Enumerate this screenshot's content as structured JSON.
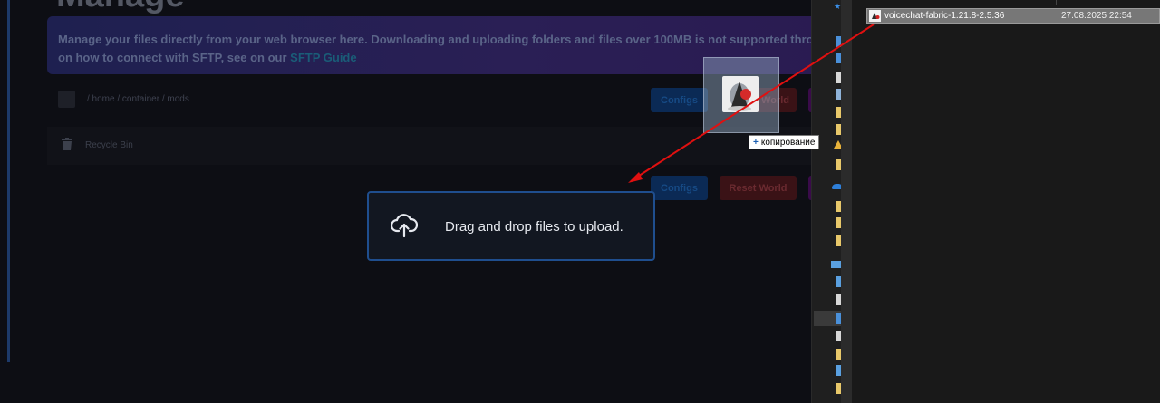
{
  "web": {
    "page_title": "Manage",
    "banner": {
      "line1": "Manage your files directly from your web browser here. Downloading and uploading folders and files over 100MB is not supported through",
      "line2_prefix": "on how to connect with SFTP, see on our ",
      "link": "SFTP Guide"
    },
    "breadcrumb": "/ home / container / mods",
    "toolbar_top": {
      "configs": "Configs",
      "reset_world": "World"
    },
    "toolbar_bottom": {
      "configs": "Configs",
      "reset_world": "Reset World"
    },
    "recycle_bin": "Recycle Bin",
    "drop_zone": {
      "text": "Drag and drop files to upload.",
      "icon": "cloud-upload-icon"
    }
  },
  "drag": {
    "tooltip_plus": "+",
    "tooltip": "копирование",
    "icon": "java-jar-icon"
  },
  "explorer": {
    "file": {
      "name": "voicechat-fabric-1.21.8-2.5.36",
      "date": "27.08.2025 22:54",
      "icon": "java-jar-icon"
    }
  },
  "colors": {
    "accent_blue": "#1f4e8e",
    "arrow_red": "#e01010",
    "selection_gray": "#777777"
  }
}
